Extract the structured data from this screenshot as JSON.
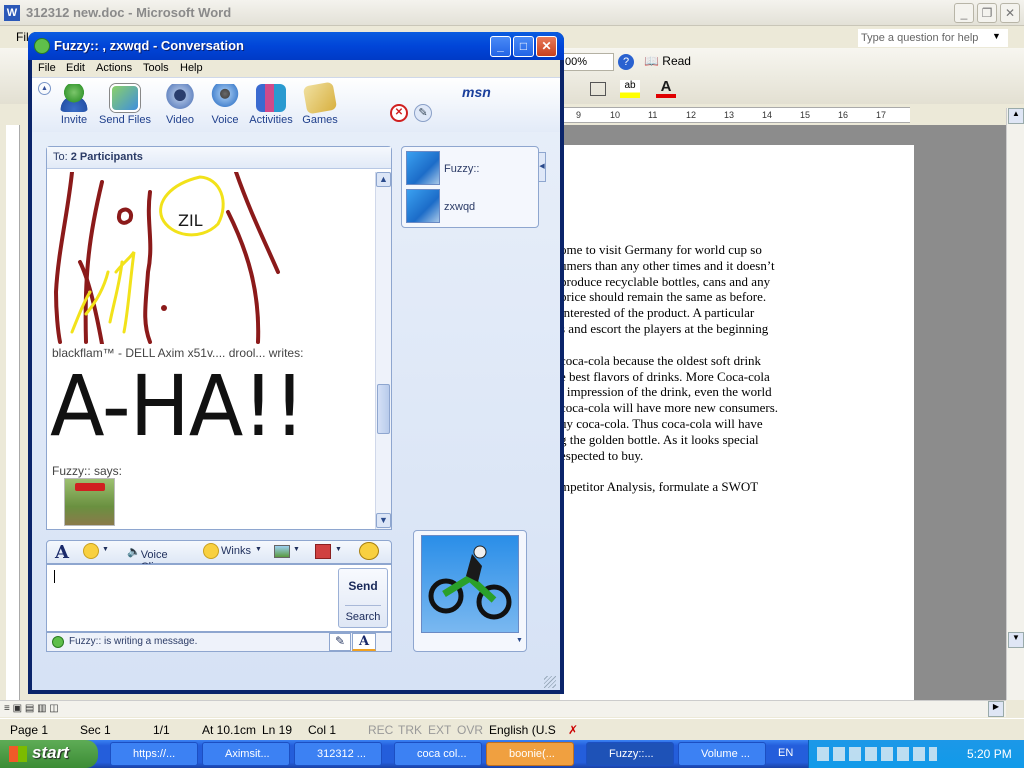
{
  "word": {
    "title": "312312 new.doc - Microsoft Word",
    "menu_first": "Fil",
    "help_placeholder": "Type a question for help",
    "zoom": "00%",
    "read_label": "Read",
    "ruler_marks": [
      "9",
      "10",
      "11",
      "12",
      "13",
      "14",
      "15",
      "16",
      "17"
    ],
    "doc_lines": [
      "ome to visit Germany for world cup so",
      "umers than any other times and it doesn’t",
      "produce recyclable bottles, cans and any",
      "price should remain the same as before.",
      "interested of the product. A particular",
      "s and escort the players at the beginning",
      "",
      "coca-cola because the oldest soft drink",
      "e best flavors of drinks. More Coca-cola",
      "l impression of the drink, even the world",
      "coca-cola will have more new consumers.",
      "uy coca-cola. Thus coca-cola will have",
      "g the golden bottle. As it looks special",
      "espected to buy.",
      "",
      "mpetitor Analysis, formulate a SWOT"
    ],
    "status": {
      "page": "Page 1",
      "sec": "Sec 1",
      "pages": "1/1",
      "at": "At 10.1cm",
      "ln": "Ln 19",
      "col": "Col 1",
      "rec": "REC",
      "trk": "TRK",
      "ext": "EXT",
      "ovr": "OVR",
      "lang": "English (U.S"
    }
  },
  "msn": {
    "title": "Fuzzy:: , zxwqd - Conversation",
    "menu": [
      "File",
      "Edit",
      "Actions",
      "Tools",
      "Help"
    ],
    "brand": "msn",
    "toolbar": [
      "Invite",
      "Send Files",
      "Video",
      "Voice",
      "Activities",
      "Games"
    ],
    "to_label": "To:",
    "to_value": "2 Participants",
    "participants": [
      "Fuzzy::",
      "zxwqd"
    ],
    "messages": [
      {
        "sender": "blackflam™ - DELL Axim x51v.... drool... writes:",
        "content": "A-HA!!"
      },
      {
        "sender": "Fuzzy:: says:",
        "content": ""
      }
    ],
    "handwriting_text": "ZIL",
    "input_toolbar": {
      "voice": "Voice Clip",
      "winks": "Winks"
    },
    "send": "Send",
    "search": "Search",
    "typing_status": "Fuzzy:: is writing a message."
  },
  "taskbar": {
    "start": "start",
    "tasks": [
      "https://...",
      "Aximsit...",
      "312312 ...",
      "coca col...",
      "boonie(...",
      "Fuzzy::...",
      "Volume ..."
    ],
    "lang": "EN",
    "clock": "5:20 PM"
  },
  "colors": {
    "xp_blue": "#245edb",
    "msn_title": "#0145d8",
    "drawing_red": "#8b1a1a",
    "drawing_yellow": "#f2e21a"
  }
}
